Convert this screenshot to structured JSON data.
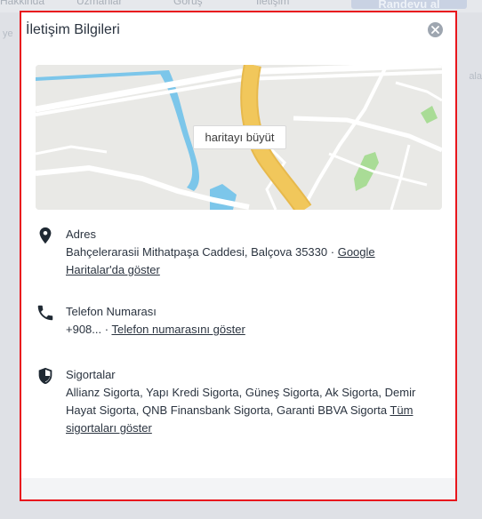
{
  "background": {
    "nav_tabs": [
      "Hakkinda",
      "Uzmanlar",
      "Görüş",
      "İletişim"
    ],
    "cta_label": "Randevu al",
    "left_fragment": "ye",
    "right_fragment": "ala"
  },
  "modal": {
    "title": "İletişim Bilgileri",
    "close_icon": "close-icon",
    "map": {
      "expand_label": "haritayı büyüt"
    },
    "address": {
      "icon": "location-pin-icon",
      "label": "Adres",
      "value": "Bahçelerarasii Mithatpaşa Caddesi, Balçova 35330",
      "separator": "·",
      "link": "Google Haritalar'da göster"
    },
    "phone": {
      "icon": "phone-icon",
      "label": "Telefon Numarası",
      "value": "+908...",
      "separator": "·",
      "link": "Telefon numarasını göster"
    },
    "insurance": {
      "icon": "shield-icon",
      "label": "Sigortalar",
      "value": "Allianz Sigorta, Yapı Kredi Sigorta, Güneş Sigorta, Ak Sigorta, Demir Hayat Sigorta, QNB Finansbank Sigorta, Garanti BBVA Sigorta",
      "link": "Tüm sigortaları göster"
    }
  },
  "colors": {
    "highlight_border": "#e8161d",
    "road_main": "#f1c75b",
    "water": "#7cc6ea",
    "park": "#a9dc96"
  }
}
